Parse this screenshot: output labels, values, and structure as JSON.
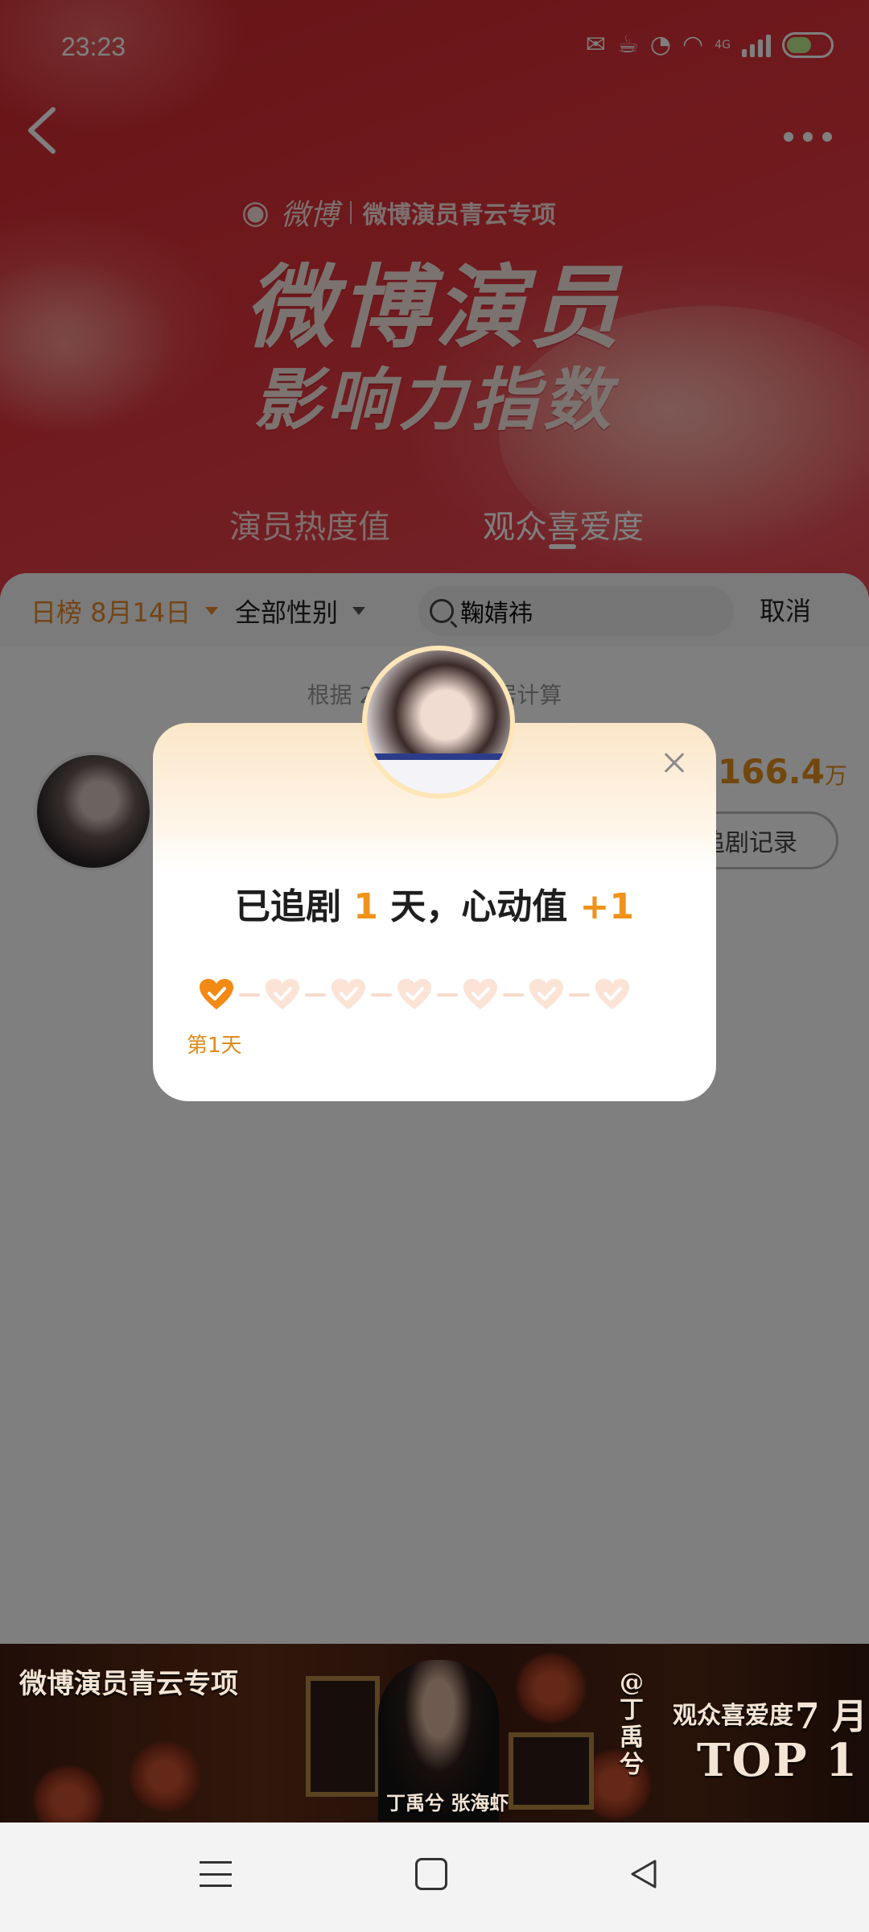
{
  "status_bar": {
    "time": "23:23",
    "network": "4G"
  },
  "hero": {
    "brand": "微博",
    "brand_sub": "微博演员青云专项",
    "title_line1": "微博演员",
    "title_line2": "影响力指数"
  },
  "tabs": [
    {
      "label": "演员热度值",
      "active": false
    },
    {
      "label": "观众喜爱度",
      "active": true
    }
  ],
  "filters": {
    "date_label": "日榜 8月14日",
    "gender_label": "全部性别",
    "search_value": "鞠婧祎",
    "cancel_label": "取消"
  },
  "list": {
    "note": "根据 2",
    "note_tail": "居计算",
    "rows": [
      {
        "value": "166.4",
        "unit": "万",
        "history_label": "追剧记录"
      }
    ]
  },
  "popup": {
    "msg_prefix": "已追剧 ",
    "days": "1",
    "msg_mid": " 天，心动值 ",
    "gain": "+1",
    "progress_days_total": 7,
    "progress_days_done": 1,
    "day_label": "第1天"
  },
  "ad_banner": {
    "title": "微博演员青云专项",
    "names": "丁禹兮   张海虾",
    "handle": "@丁禹兮",
    "rank_label": "观众喜爱度",
    "month": "7 月",
    "rank": "TOP 1"
  },
  "colors": {
    "accent": "#f0931c",
    "hero_red": "#d92c33"
  }
}
